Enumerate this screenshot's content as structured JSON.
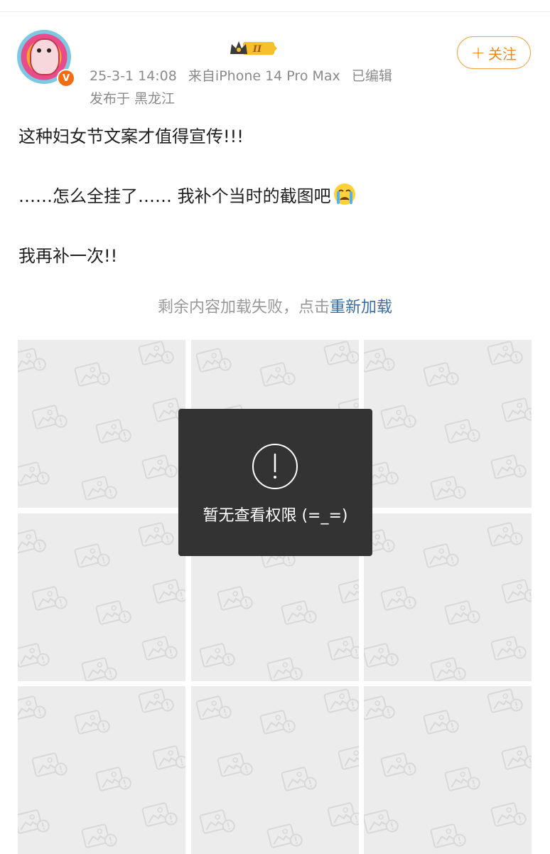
{
  "post": {
    "meta": {
      "date": "25-3-1 14:08",
      "source": "来自iPhone 14 Pro Max",
      "edited": "已编辑",
      "location": "发布于 黑龙江"
    },
    "rank_badge": "II",
    "verified_badge": "V",
    "follow_label": "关注",
    "lines": [
      "这种妇女节文案才值得宣传!!!",
      "……怎么全挂了…… 我补个当时的截图吧",
      "我再补一次!!"
    ],
    "emoji": "crying-face-icon",
    "reload": {
      "prefix": "剩余内容加载失败，点击",
      "link": "重新加载"
    }
  },
  "image_grid": {
    "count": 9,
    "state": "placeholder"
  },
  "toast": {
    "message": "暂无查看权限 (=_=)"
  },
  "colors": {
    "accent_orange": "#f08a1a",
    "link_blue": "#3a6ea5",
    "meta_gray": "#8a8a8a",
    "toast_bg": "#333333"
  }
}
